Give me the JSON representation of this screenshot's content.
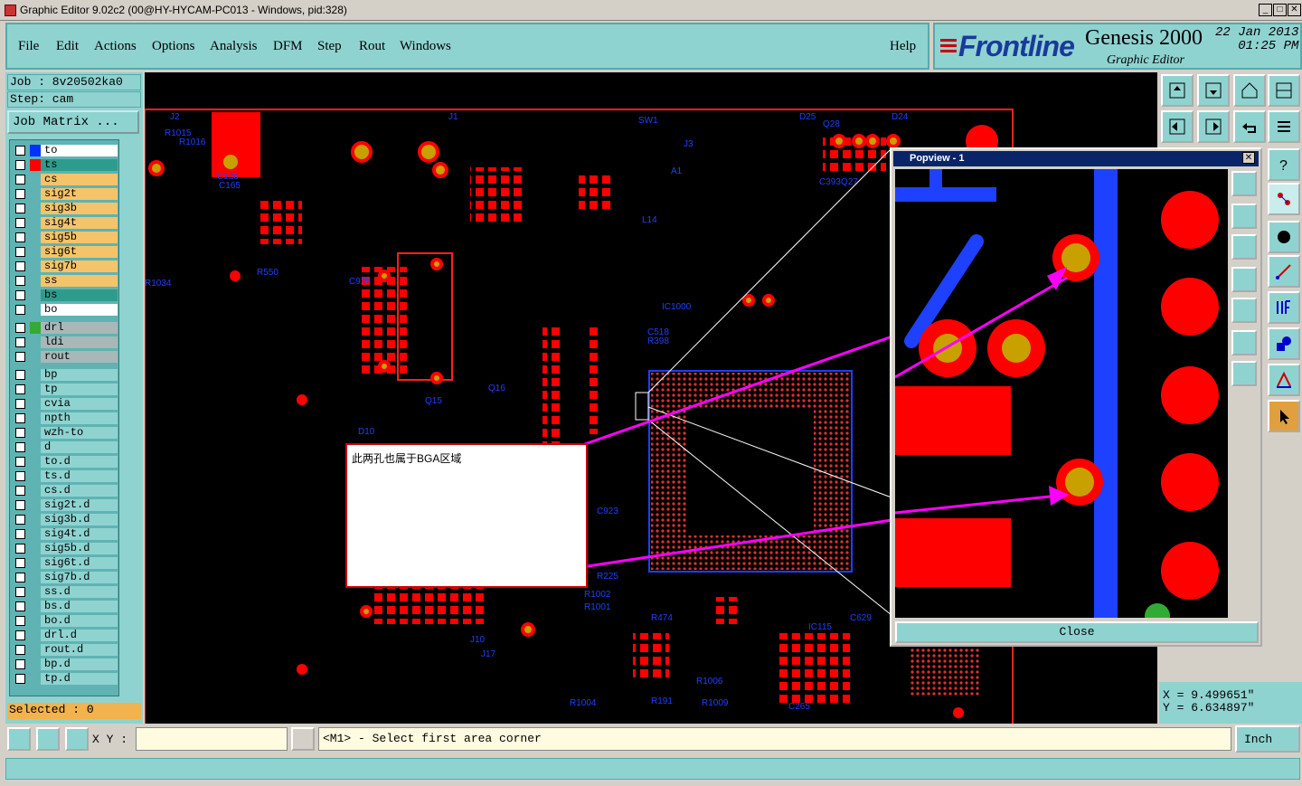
{
  "window": {
    "title": "Graphic Editor 9.02c2 (00@HY-HYCAM-PC013 - Windows, pid:328)",
    "min": "_",
    "max": "□",
    "close": "✕"
  },
  "menu": {
    "items": [
      "File",
      "Edit",
      "Actions",
      "Options",
      "Analysis",
      "DFM",
      "Step",
      "Rout",
      "Windows"
    ],
    "help": "Help"
  },
  "brand": {
    "frontline": "Frontline",
    "product": "Genesis 2000",
    "subtitle": "Graphic Editor",
    "date": "22 Jan 2013",
    "time": "01:25 PM"
  },
  "job": {
    "job_line": "Job : 8v20502ka0",
    "step_line": "Step: cam",
    "job_matrix": "Job Matrix ...",
    "selected": "Selected : 0"
  },
  "layers": [
    {
      "name": "to",
      "color": "#ffffff",
      "swatch": "#0033ff"
    },
    {
      "name": "ts",
      "color": "#2e9c8c",
      "swatch": "#ff0000"
    },
    {
      "name": "cs",
      "color": "#f5c36a",
      "swatch": ""
    },
    {
      "name": "sig2t",
      "color": "#f5c36a",
      "swatch": ""
    },
    {
      "name": "sig3b",
      "color": "#f5c36a",
      "swatch": ""
    },
    {
      "name": "sig4t",
      "color": "#f5c36a",
      "swatch": ""
    },
    {
      "name": "sig5b",
      "color": "#f5c36a",
      "swatch": ""
    },
    {
      "name": "sig6t",
      "color": "#f5c36a",
      "swatch": ""
    },
    {
      "name": "sig7b",
      "color": "#f5c36a",
      "swatch": ""
    },
    {
      "name": "ss",
      "color": "#f5c36a",
      "swatch": ""
    },
    {
      "name": "bs",
      "color": "#2e9c8c",
      "swatch": ""
    },
    {
      "name": "bo",
      "color": "#ffffff",
      "swatch": ""
    },
    {
      "name": "drl",
      "color": "#a8b8b8",
      "swatch": "#33aa33"
    },
    {
      "name": "ldi",
      "color": "#a8b8b8",
      "swatch": ""
    },
    {
      "name": "rout",
      "color": "#a8b8b8",
      "swatch": ""
    },
    {
      "name": "bp",
      "color": "#8fd3d1",
      "swatch": ""
    },
    {
      "name": "tp",
      "color": "#8fd3d1",
      "swatch": ""
    },
    {
      "name": "cvia",
      "color": "#8fd3d1",
      "swatch": ""
    },
    {
      "name": "npth",
      "color": "#8fd3d1",
      "swatch": ""
    },
    {
      "name": "wzh-to",
      "color": "#8fd3d1",
      "swatch": ""
    },
    {
      "name": "d",
      "color": "#8fd3d1",
      "swatch": ""
    },
    {
      "name": "to.d",
      "color": "#8fd3d1",
      "swatch": ""
    },
    {
      "name": "ts.d",
      "color": "#8fd3d1",
      "swatch": ""
    },
    {
      "name": "cs.d",
      "color": "#8fd3d1",
      "swatch": ""
    },
    {
      "name": "sig2t.d",
      "color": "#8fd3d1",
      "swatch": ""
    },
    {
      "name": "sig3b.d",
      "color": "#8fd3d1",
      "swatch": ""
    },
    {
      "name": "sig4t.d",
      "color": "#8fd3d1",
      "swatch": ""
    },
    {
      "name": "sig5b.d",
      "color": "#8fd3d1",
      "swatch": ""
    },
    {
      "name": "sig6t.d",
      "color": "#8fd3d1",
      "swatch": ""
    },
    {
      "name": "sig7b.d",
      "color": "#8fd3d1",
      "swatch": ""
    },
    {
      "name": "ss.d",
      "color": "#8fd3d1",
      "swatch": ""
    },
    {
      "name": "bs.d",
      "color": "#8fd3d1",
      "swatch": ""
    },
    {
      "name": "bo.d",
      "color": "#8fd3d1",
      "swatch": ""
    },
    {
      "name": "drl.d",
      "color": "#8fd3d1",
      "swatch": ""
    },
    {
      "name": "rout.d",
      "color": "#8fd3d1",
      "swatch": ""
    },
    {
      "name": "bp.d",
      "color": "#8fd3d1",
      "swatch": ""
    },
    {
      "name": "tp.d",
      "color": "#8fd3d1",
      "swatch": ""
    }
  ],
  "canvas_labels": [
    "J2",
    "J1",
    "SW1",
    "D25",
    "D24",
    "R1015",
    "R1016",
    "C165",
    "C128",
    "R1034",
    "R550",
    "IC1000",
    "C923",
    "R225",
    "R1002",
    "R1001",
    "J10",
    "J17",
    "R1004",
    "R191",
    "R1006",
    "R1009",
    "C265",
    "R474",
    "IC115",
    "C629",
    "D10",
    "Q15",
    "Q16",
    "C518",
    "R398",
    "C925",
    "J3",
    "A1",
    "L14",
    "C393",
    "Q27",
    "Q28"
  ],
  "note": {
    "text": "此两孔也属于BGA区域"
  },
  "popview": {
    "title": "Popview - 1",
    "close_label": "Close"
  },
  "coords": {
    "x": "X = 9.499651\"",
    "y": "Y = 6.634897\""
  },
  "bottom": {
    "xy_label": "X Y :",
    "xy_value": "",
    "prompt": "<M1> - Select first area corner",
    "units": "Inch"
  },
  "colors": {
    "teal": "#8fd3d1",
    "pcb_red": "#ff0000",
    "pcb_blue": "#1e40ff",
    "magenta": "#ff00ff",
    "gold": "#c8a000"
  }
}
